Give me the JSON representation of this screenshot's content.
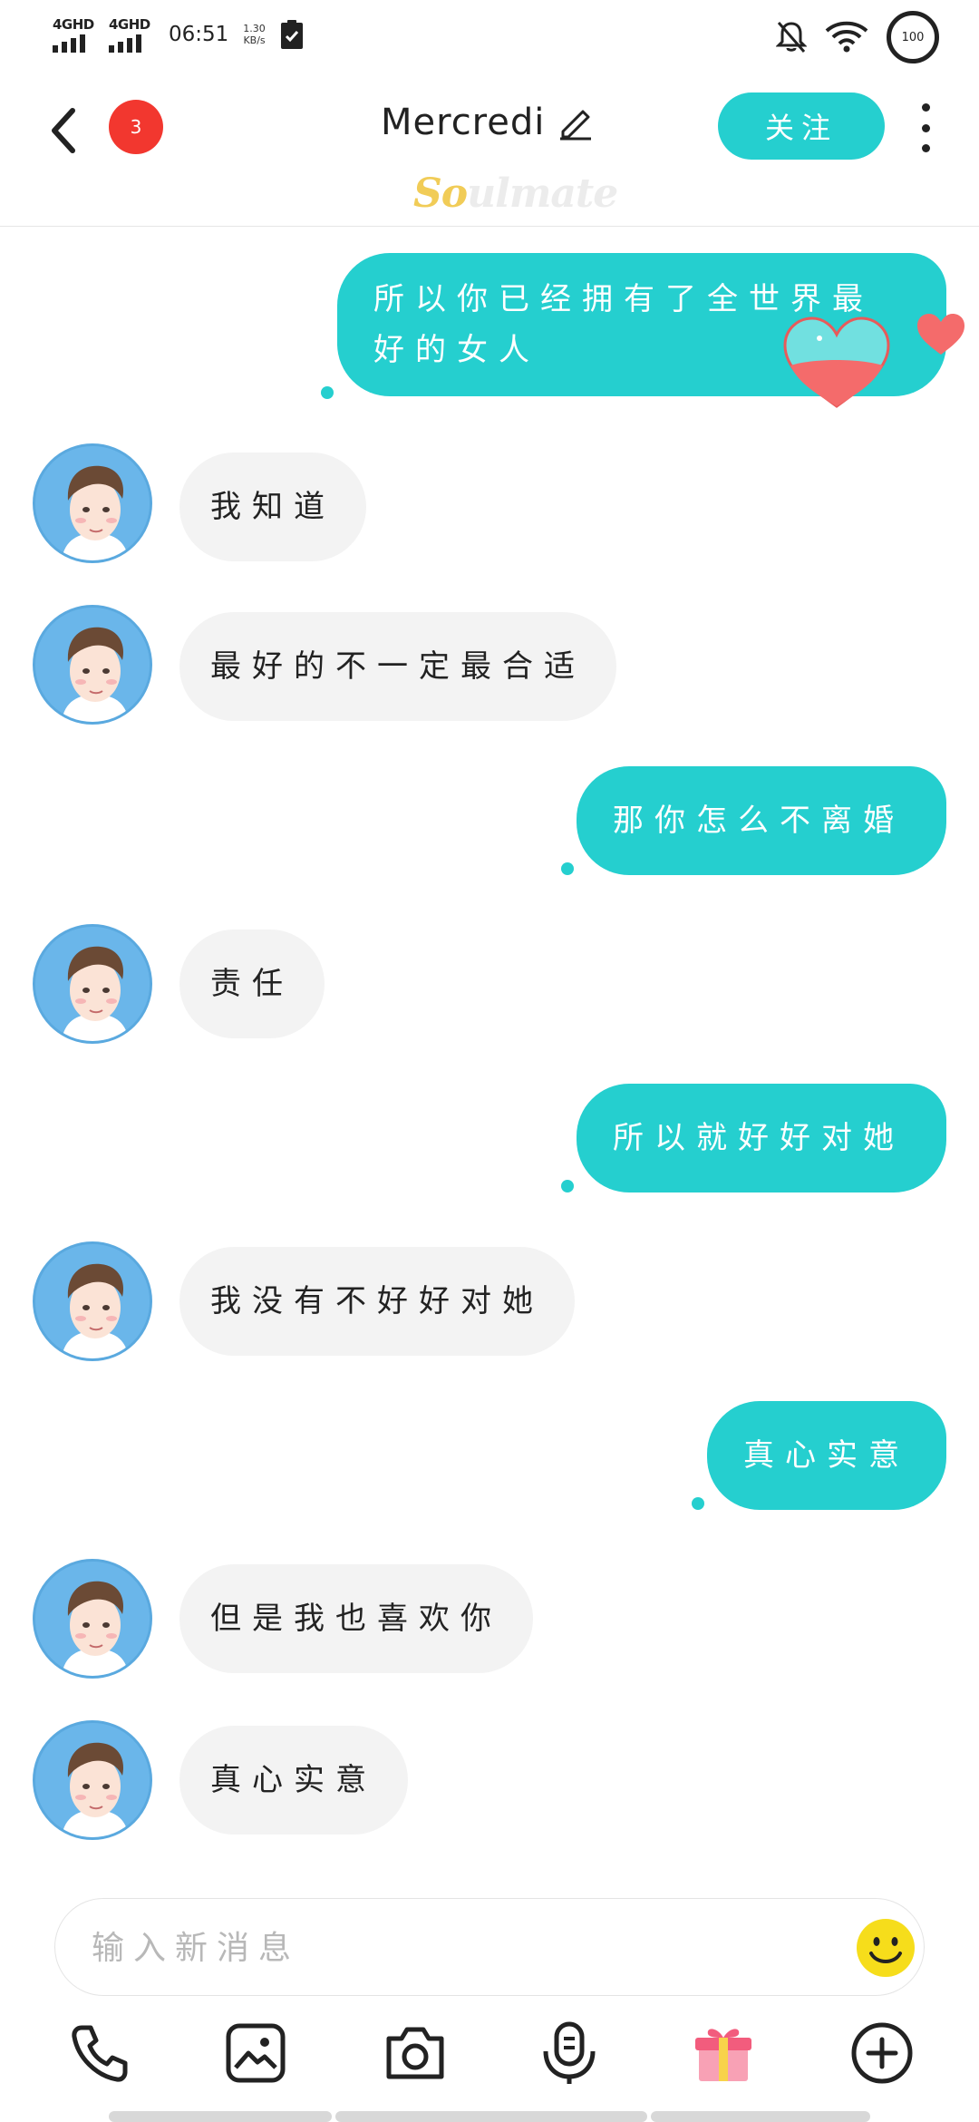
{
  "status_bar": {
    "network_1": "4GHD",
    "network_2": "4GHD",
    "time": "06:51",
    "speed_value": "1.30",
    "speed_unit": "KB/s",
    "battery": "100"
  },
  "header": {
    "back_icon": "chevron-left-icon",
    "unread_count": "3",
    "title": "Mercredi",
    "edit_icon": "pencil-icon",
    "follow_label": "关注",
    "more_icon": "kebab-menu-icon",
    "brand_so": "So",
    "brand_rest": "ulmate"
  },
  "messages": [
    {
      "side": "out",
      "text_line1": "所以你已经拥有了全世界最",
      "text_line2": "好的女人"
    },
    {
      "side": "in",
      "text": "我知道"
    },
    {
      "side": "in",
      "text": "最好的不一定最合适"
    },
    {
      "side": "out",
      "text": "那你怎么不离婚"
    },
    {
      "side": "in",
      "text": "责任"
    },
    {
      "side": "out",
      "text": "所以就好好对她"
    },
    {
      "side": "in",
      "text": "我没有不好好对她"
    },
    {
      "side": "out",
      "text": "真心实意"
    },
    {
      "side": "in",
      "text": "但是我也喜欢你"
    },
    {
      "side": "in",
      "text": "真心实意"
    }
  ],
  "input": {
    "placeholder": "输入新消息",
    "value": ""
  },
  "toolbar": {
    "icons": [
      "phone-icon",
      "image-icon",
      "camera-icon",
      "voice-icon",
      "gift-icon",
      "plus-icon"
    ]
  },
  "colors": {
    "accent": "#25cfcf",
    "incoming_bubble": "#f3f3f3",
    "badge": "#f2372f",
    "heart": "#f46b6b",
    "avatar_bg": "#6ab6ea"
  }
}
